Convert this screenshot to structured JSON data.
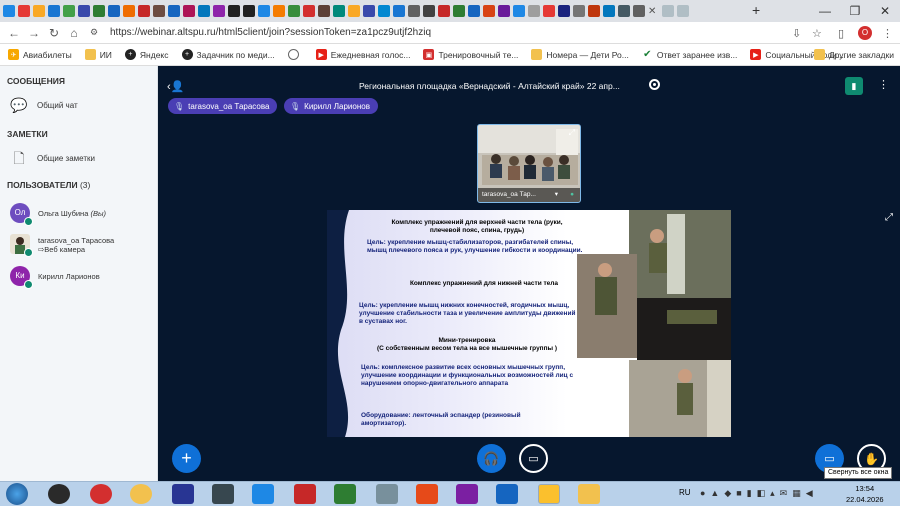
{
  "browser": {
    "url": "https://webinar.altspu.ru/html5client/join?sessionToken=za1pcz9utjf2hziq",
    "profile_initial": "O",
    "new_tab": "+",
    "bookmarks": [
      {
        "label": "Авиабилеты",
        "color": "#f7a800"
      },
      {
        "label": "ИИ",
        "color": "#f2c14e"
      },
      {
        "label": "Яндекс",
        "color": "#222222"
      },
      {
        "label": "Задачник по меди...",
        "color": "#222222"
      },
      {
        "label": "",
        "color": "#444444"
      },
      {
        "label": "Ежедневная голос...",
        "color": "#e62117"
      },
      {
        "label": "Тренировочный те...",
        "color": "#d32f2f"
      },
      {
        "label": "Номера — Дети Ро...",
        "color": "#f2c14e"
      },
      {
        "label": "Ответ заранее изв...",
        "color": "#1a7f37"
      },
      {
        "label": "Социальный роли...",
        "color": "#e62117"
      }
    ],
    "other_bookmarks": "Другие закладки"
  },
  "sidebar": {
    "messages_header": "СООБЩЕНИЯ",
    "public_chat": "Общий чат",
    "notes_header": "ЗАМЕТКИ",
    "shared_notes": "Общие заметки",
    "users_header": "ПОЛЬЗОВАТЕЛИ",
    "users_count": "(3)",
    "users": [
      {
        "initials": "Ол",
        "name": "Ольга Шубина",
        "suffix": "(Вы)",
        "sub": "",
        "color": "#6d4dbf"
      },
      {
        "initials": "",
        "name": "tarasova_oa Тарасова",
        "suffix": "",
        "sub": "⇨Веб камера",
        "color": "#2e7d4f"
      },
      {
        "initials": "Ки",
        "name": "Кирилл Ларионов",
        "suffix": "",
        "sub": "",
        "color": "#8e24aa"
      }
    ]
  },
  "meeting": {
    "title": "Региональная площадка «Вернадский - Алтайский край» 22 апр...",
    "talkers": [
      "tarasova_oa Тарасова",
      "Кирилл Ларионов"
    ],
    "webcam_name": "tarasova_oa Тар...",
    "slide": {
      "h1": "Комплекс упражнений для верхней части тела (руки, плечевой пояс, спина, грудь)",
      "p1": "Цель: укрепление мышц-стабилизаторов, разгибателей спины, мышц плечевого пояса и рук, улучшение гибкости и координации.",
      "h2": "Комплекс упражнений для нижней части тела",
      "p2": "Цель: укрепление мышц нижних конечностей, ягодичных мышц, улучшение стабильности таза и увеличение амплитуды движений в суставах ног.",
      "h3": "Мини-тренировка",
      "h3b": "(С собственным весом тела на все мышечные группы )",
      "p3": "Цель: комплексное развитие всех основных мышечных групп, улучшение координации и функциональных возможностей лиц с нарушением опорно-двигательного аппарата",
      "p4": "Оборудование: ленточный эспандер (резиновый амортизатор)."
    },
    "tooltip": "Свернуть все окна"
  },
  "taskbar": {
    "lang": "RU",
    "time": "13:54",
    "date": "22.04.2026"
  },
  "colors": {
    "accent": "#0f70d7",
    "talker": "#4a3eb4",
    "stage": "#06172e"
  }
}
